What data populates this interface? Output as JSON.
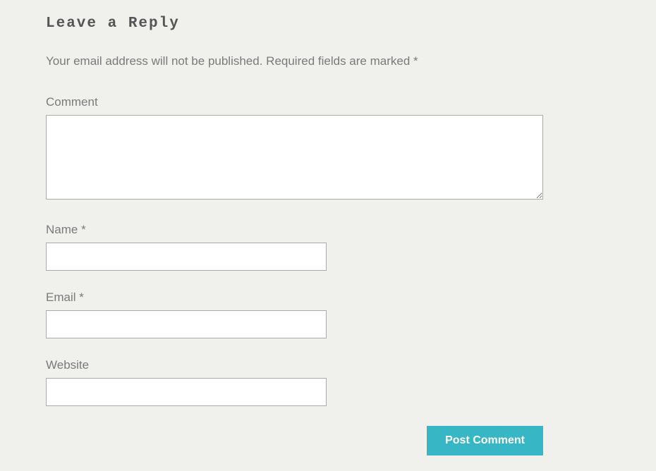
{
  "heading": "Leave a Reply",
  "notice": "Your email address will not be published. Required fields are marked *",
  "fields": {
    "comment": {
      "label": "Comment",
      "value": ""
    },
    "name": {
      "label": "Name *",
      "value": ""
    },
    "email": {
      "label": "Email *",
      "value": ""
    },
    "website": {
      "label": "Website",
      "value": ""
    }
  },
  "submit": {
    "label": "Post Comment"
  }
}
